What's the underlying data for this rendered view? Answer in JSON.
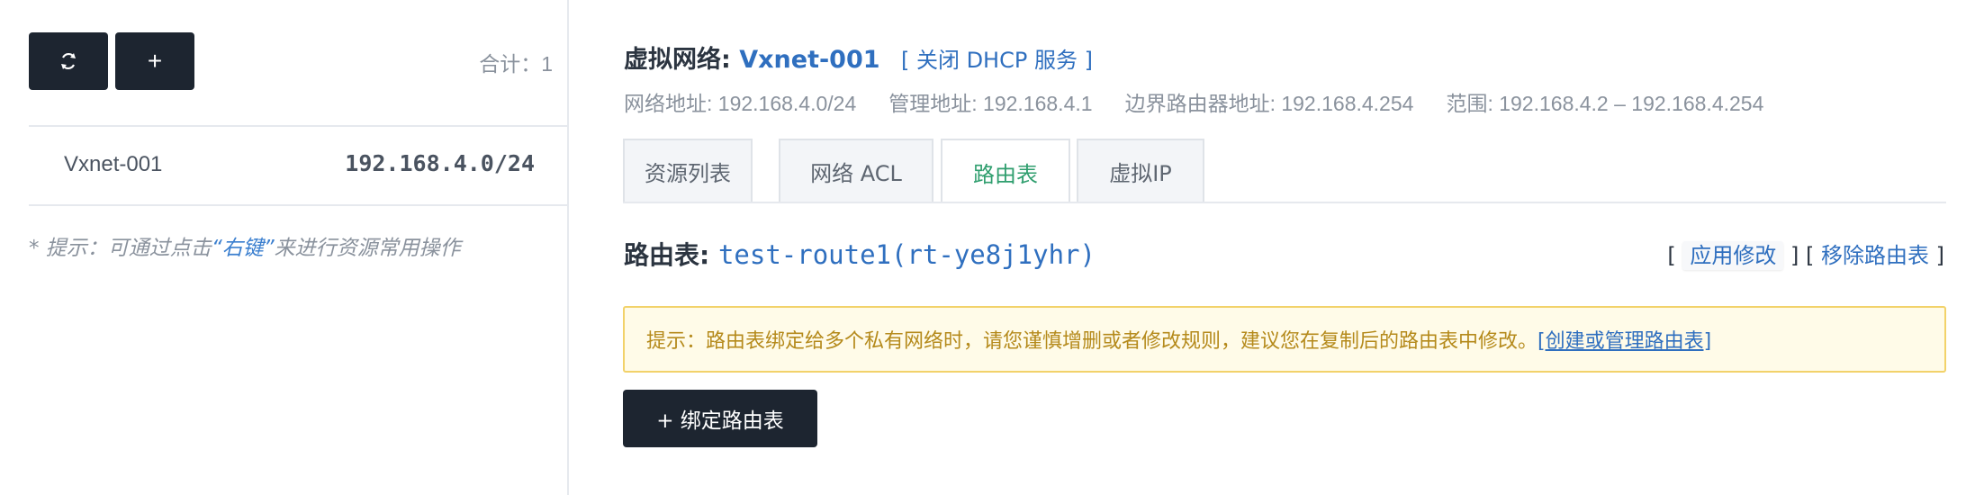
{
  "left_panel": {
    "refresh_icon": "refresh-icon",
    "add_label": "+",
    "total": "合计：1",
    "items": [
      {
        "name": "Vxnet-001",
        "cidr": "192.168.4.0/24"
      }
    ],
    "hint_prefix": "* 提示：可通过点击",
    "hint_quote": "“右键”",
    "hint_suffix": "来进行资源常用操作"
  },
  "vnet": {
    "title_label": "虚拟网络:",
    "name": "Vxnet-001",
    "dhcp_link": "[ 关闭 DHCP 服务 ]",
    "network_address": "网络地址: 192.168.4.0/24",
    "manage_address": "管理地址: 192.168.4.1",
    "edge_router": "边界路由器地址: 192.168.4.254",
    "range": "范围: 192.168.4.2 – 192.168.4.254"
  },
  "tabs": [
    {
      "label": "资源列表",
      "active": false
    },
    {
      "label": "网络 ACL",
      "active": false
    },
    {
      "label": "路由表",
      "active": true
    },
    {
      "label": "虚拟IP",
      "active": false
    }
  ],
  "route": {
    "title_label": "路由表:",
    "route_id": "test-route1(rt-ye8j1yhr)",
    "bracket_open": "[",
    "apply_label": "应用修改",
    "bracket_mid": "] [",
    "remove_label": "移除路由表",
    "bracket_close": "]"
  },
  "warning": {
    "text": "提示：路由表绑定给多个私有网络时，请您谨慎增删或者修改规则，建议您在复制后的路由表中修改。",
    "link": "[创建或管理路由表]"
  },
  "bind_button": {
    "label": "+ 绑定路由表"
  },
  "colors": {
    "dark_button": "#1d2530",
    "link_blue": "#2f6fbf",
    "active_tab_green": "#2f9e6e",
    "warning_bg": "#fffbe8",
    "warning_border": "#f2d26a",
    "warning_text": "#b58a1b"
  }
}
